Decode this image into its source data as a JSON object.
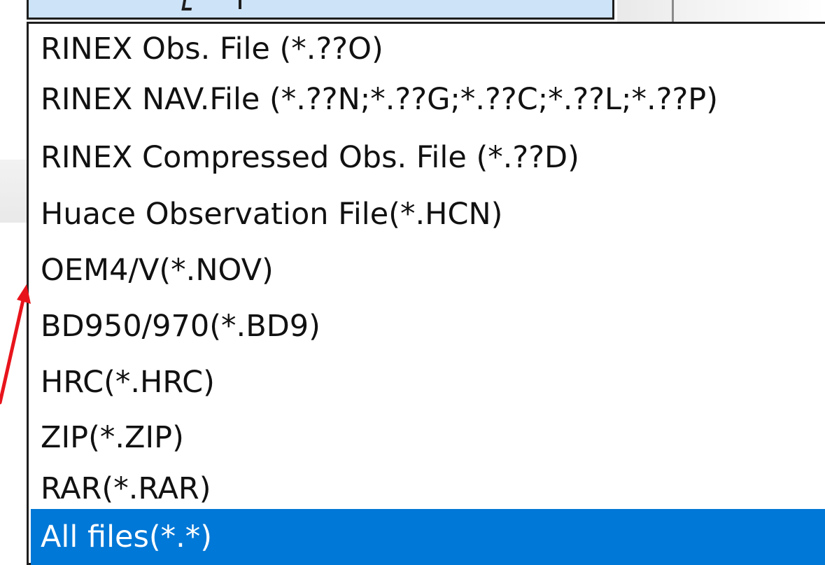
{
  "dropdown": {
    "selected_index": 9,
    "options": [
      {
        "label": "RINEX Obs. File (*.??O)"
      },
      {
        "label": "RINEX NAV.File (*.??N;*.??G;*.??C;*.??L;*.??P)"
      },
      {
        "label": "RINEX Compressed Obs. File (*.??D)"
      },
      {
        "label": "Huace Observation File(*.HCN)"
      },
      {
        "label": "OEM4/V(*.NOV)"
      },
      {
        "label": "BD950/970(*.BD9)"
      },
      {
        "label": "HRC(*.HRC)"
      },
      {
        "label": "ZIP(*.ZIP)"
      },
      {
        "label": "RAR(*.RAR)"
      },
      {
        "label": "All files(*.*)"
      }
    ]
  },
  "colors": {
    "selection": "#0078d7",
    "combo_field": "#cde3f7",
    "annotation_arrow": "#e8141c"
  },
  "annotation": {
    "type": "arrow",
    "color": "#e8141c"
  }
}
